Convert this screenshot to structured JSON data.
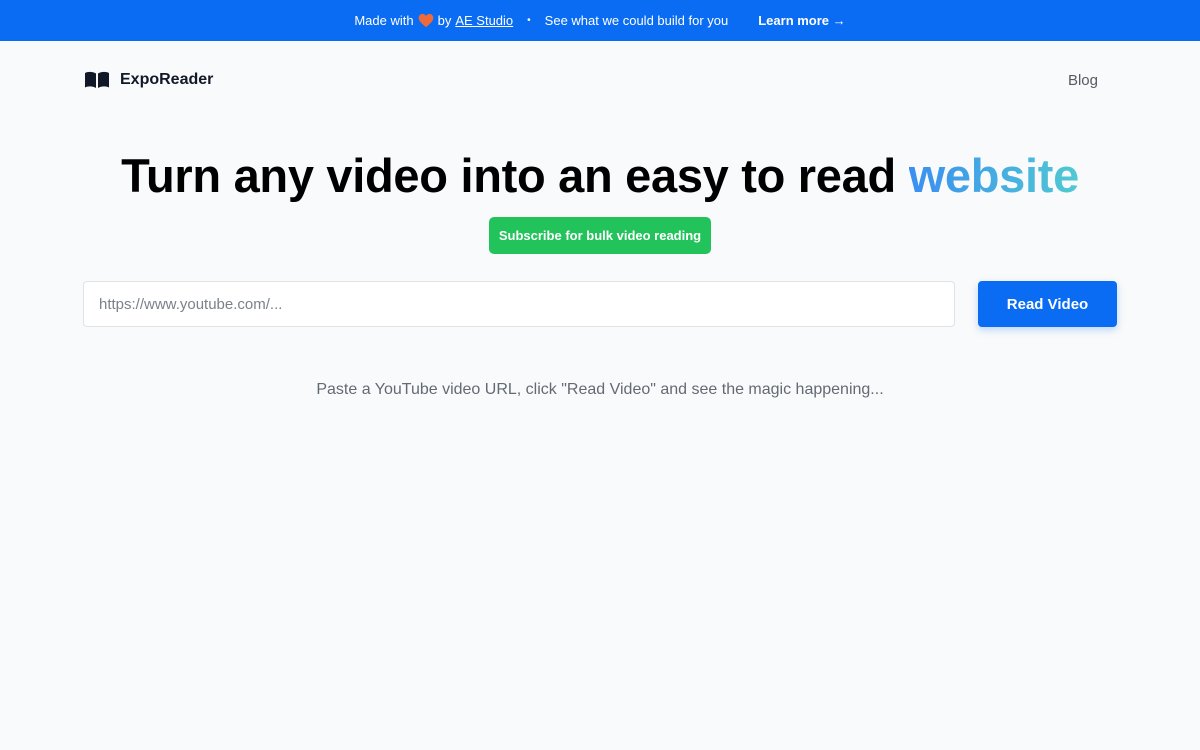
{
  "banner": {
    "made_with": "Made with",
    "by": "by",
    "studio_link": "AE Studio",
    "separator": "•",
    "pitch": "See what we could build for you",
    "learn_more": "Learn more →"
  },
  "nav": {
    "brand": "ExpoReader",
    "blog": "Blog"
  },
  "hero": {
    "headline_main": "Turn any video into an easy to read ",
    "headline_accent": "website"
  },
  "subscribe_label": "Subscribe for bulk video reading",
  "search": {
    "placeholder": "https://www.youtube.com/...",
    "value": "",
    "button_label": "Read Video"
  },
  "hint": "Paste a YouTube video URL, click \"Read Video\" and see the magic happening...",
  "colors": {
    "brand_blue": "#0a6cf2",
    "subscribe_green": "#22c35a",
    "gradient_start": "#3b8ef0",
    "gradient_end": "#50c9d3",
    "heart": "#ef6a3a"
  },
  "icons": {
    "heart": "heart-icon",
    "brand": "open-book-icon"
  }
}
